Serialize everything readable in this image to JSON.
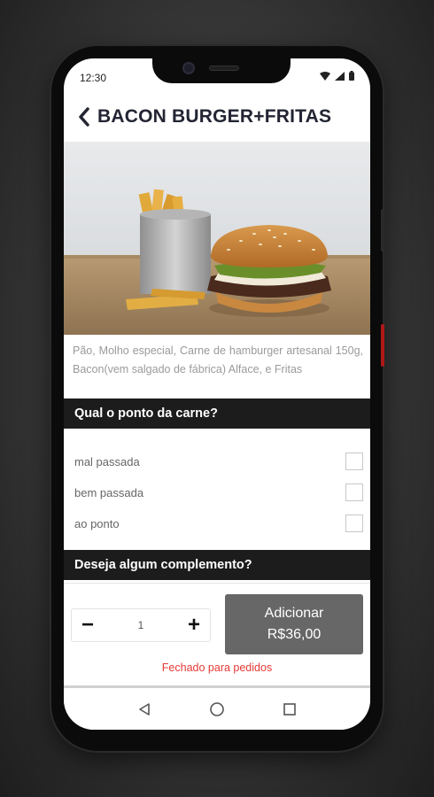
{
  "status_bar": {
    "time": "12:30",
    "icons": [
      "wifi-icon",
      "signal-icon",
      "battery-icon"
    ]
  },
  "header": {
    "back_icon": "chevron-left-icon",
    "title": "BACON BURGER+FRITAS"
  },
  "product": {
    "image": "burger-photo",
    "description": "Pão, Molho especial, Carne de hamburger artesanal 150g, Bacon(vem salgado de fábrica) Alface, e Fritas"
  },
  "section_doneness": {
    "title": "Qual o ponto da carne?",
    "options": [
      {
        "label": "mal passada",
        "checked": false
      },
      {
        "label": "bem passada",
        "checked": false
      },
      {
        "label": "ao ponto",
        "checked": false
      }
    ]
  },
  "section_complement": {
    "title": "Deseja algum complemento?"
  },
  "order": {
    "minus": "−",
    "quantity": "1",
    "plus": "+",
    "add_label": "Adicionar",
    "price": "R$36,00",
    "closed_message": "Fechado para pedidos"
  },
  "navigation": {
    "icons": [
      "back-triangle-icon",
      "home-circle-icon",
      "recents-square-icon"
    ]
  },
  "colors": {
    "section_bg": "#1c1c1c",
    "button_bg": "#676767",
    "closed_text": "#e53935",
    "title_text": "#232533"
  }
}
